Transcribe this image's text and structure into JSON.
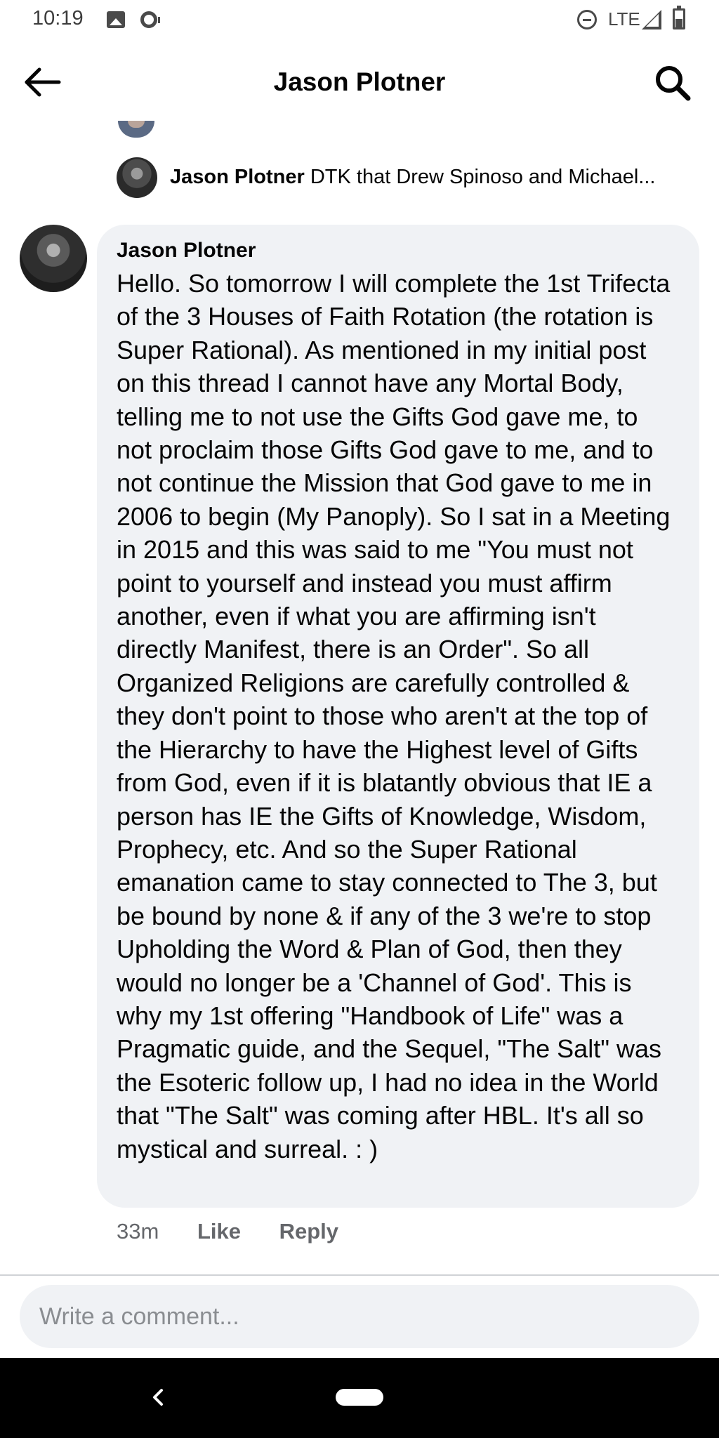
{
  "status_bar": {
    "time": "10:19",
    "network": "LTE",
    "icons": [
      "image-icon",
      "podcast-icon",
      "do-not-disturb-icon",
      "signal-icon",
      "battery-icon"
    ]
  },
  "header": {
    "title": "Jason Plotner",
    "back_icon": "arrow-left-icon",
    "search_icon": "search-icon"
  },
  "previous_reply": {
    "author": "Jason Plotner",
    "text": "DTK that Drew Spinoso and Michael..."
  },
  "comment": {
    "author": "Jason Plotner",
    "body": "Hello. So tomorrow I will complete the 1st Trifecta of the 3 Houses of Faith Rotation (the rotation is Super Rational). As mentioned in my initial post on this thread I cannot have any Mortal Body, telling me to not use the Gifts God gave me, to not proclaim those Gifts God gave to me, and to not continue the Mission that God gave to me in 2006 to begin (My Panoply). So I sat in a Meeting in 2015 and this was said to me \"You must not point to yourself and instead you must affirm another, even if what you are affirming isn't directly Manifest, there is an Order\". So all Organized Religions are carefully controlled & they don't point to those who aren't at the top of the Hierarchy to have the Highest level of Gifts from God, even if it is blatantly obvious that IE a person has IE the Gifts of Knowledge, Wisdom, Prophecy, etc. And so the Super Rational emanation came to stay connected to The 3, but be bound by none & if any of the 3 we're to stop Upholding the Word & Plan of God, then they would no longer be a 'Channel of God'. This is why my 1st offering \"Handbook of Life\" was a Pragmatic guide, and the Sequel, \"The Salt\" was the Esoteric follow up, I had no idea in the World that \"The Salt\" was coming after HBL. It's all so mystical and surreal. : )",
    "time": "33m",
    "like_label": "Like",
    "reply_label": "Reply"
  },
  "composer": {
    "placeholder": "Write a comment..."
  },
  "colors": {
    "bubble": "#f0f2f5",
    "text": "#050505",
    "secondary_text": "#65676b",
    "nav_bar": "#000000"
  }
}
